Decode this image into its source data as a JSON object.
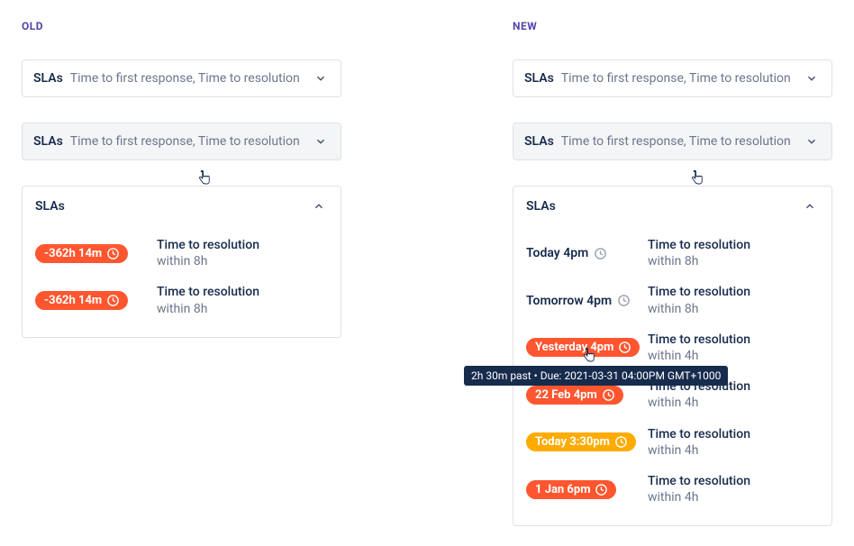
{
  "old": {
    "heading": "OLD",
    "field_collapsed": {
      "label": "SLAs",
      "value": "Time to first response, Time to resolution"
    },
    "field_hover": {
      "label": "SLAs",
      "value": "Time to first response, Time to resolution"
    },
    "panel": {
      "title": "SLAs",
      "rows": [
        {
          "badge_text": "-362h 14m",
          "badge_color": "red",
          "name": "Time to resolution",
          "within": "within 8h"
        },
        {
          "badge_text": "-362h 14m",
          "badge_color": "red",
          "name": "Time to resolution",
          "within": "within 8h"
        }
      ]
    }
  },
  "new": {
    "heading": "NEW",
    "field_collapsed": {
      "label": "SLAs",
      "value": "Time to first response, Time to resolution"
    },
    "field_hover": {
      "label": "SLAs",
      "value": "Time to first response, Time to resolution"
    },
    "panel": {
      "title": "SLAs",
      "rows": [
        {
          "plain": true,
          "badge_text": "Today 4pm",
          "name": "Time to resolution",
          "within": "within 8h"
        },
        {
          "plain": true,
          "badge_text": "Tomorrow 4pm",
          "name": "Time to resolution",
          "within": "within 8h"
        },
        {
          "badge_color": "red",
          "badge_text": "Yesterday 4pm",
          "name": "Time to resolution",
          "within": "within 4h"
        },
        {
          "badge_color": "red",
          "badge_text": "22 Feb 4pm",
          "name": "Time to resolution",
          "within": "within 4h"
        },
        {
          "badge_color": "orange",
          "badge_text": "Today 3:30pm",
          "name": "Time to resolution",
          "within": "within 4h"
        },
        {
          "badge_color": "red",
          "badge_text": "1 Jan 6pm",
          "name": "Time to resolution",
          "within": "within 4h"
        }
      ]
    },
    "tooltip": "2h 30m past • Due: 2021-03-31 04:00PM GMT+1000"
  }
}
